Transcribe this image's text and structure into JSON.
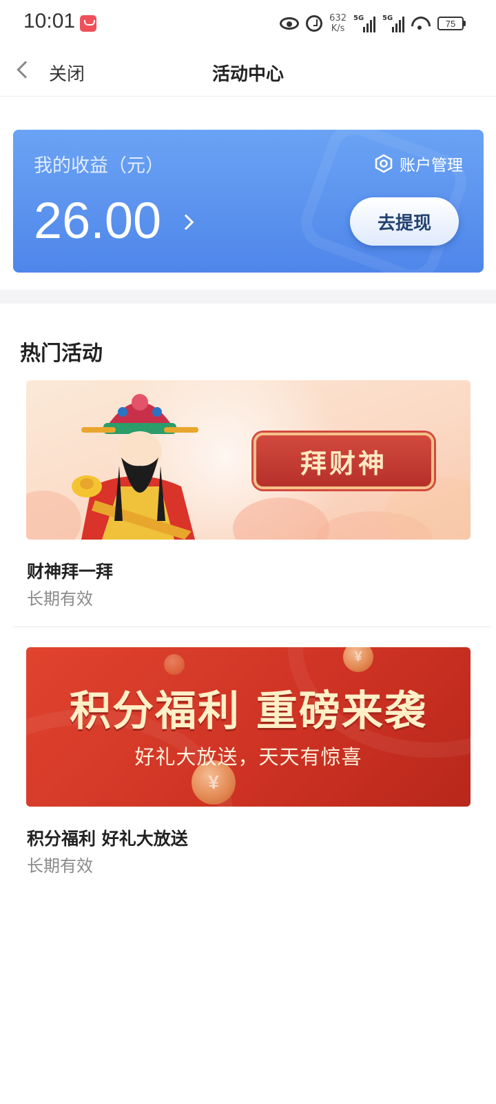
{
  "status_bar": {
    "time": "10:01",
    "net_speed_value": "632",
    "net_speed_unit": "K/s",
    "signal_1_label": "5G",
    "signal_2_label": "5G",
    "battery_level": "75"
  },
  "nav": {
    "back_label": "关闭",
    "title": "活动中心"
  },
  "earnings": {
    "label": "我的收益（元）",
    "amount": "26.00",
    "account_manage_label": "账户管理",
    "withdraw_label": "去提现"
  },
  "hot_activities": {
    "title": "热门活动",
    "items": [
      {
        "banner_badge": "拜财神",
        "name": "财神拜一拜",
        "validity": "长期有效"
      },
      {
        "banner_headline": "积分福利 重磅来袭",
        "banner_sub": "好礼大放送，天天有惊喜",
        "name": "积分福利 好礼大放送",
        "validity": "长期有效"
      }
    ]
  },
  "colors": {
    "card_blue": "#5b93ee",
    "withdraw_text": "#23416f",
    "points_red": "#cf3324",
    "badge_red": "#c13a32"
  }
}
